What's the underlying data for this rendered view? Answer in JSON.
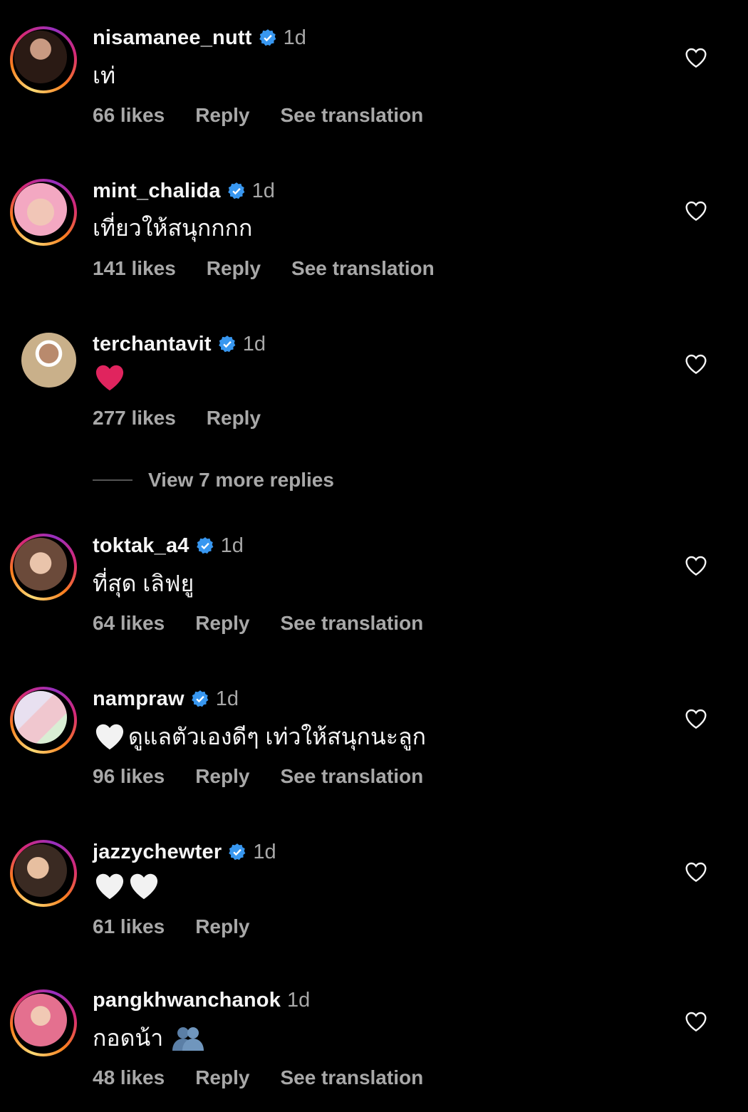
{
  "comments": [
    {
      "username": "nisamanee_nutt",
      "time": "1d",
      "text": "เท่",
      "likes": "66 likes",
      "reply": "Reply",
      "translate": "See translation"
    },
    {
      "username": "mint_chalida",
      "time": "1d",
      "text": "เที่ยวให้สนุกกกก",
      "likes": "141 likes",
      "reply": "Reply",
      "translate": "See translation"
    },
    {
      "username": "terchantavit",
      "time": "1d",
      "likes": "277 likes",
      "reply": "Reply"
    },
    {
      "username": "toktak_a4",
      "time": "1d",
      "text": "ที่สุด เลิฟยู",
      "likes": "64 likes",
      "reply": "Reply",
      "translate": "See translation"
    },
    {
      "username": "nampraw",
      "time": "1d",
      "text": "ดูแลตัวเองดีๆ เท่วให้สนุกนะลูก",
      "likes": "96 likes",
      "reply": "Reply",
      "translate": "See translation"
    },
    {
      "username": "jazzychewter",
      "time": "1d",
      "likes": "61 likes",
      "reply": "Reply"
    },
    {
      "username": "pangkhwanchanok",
      "time": "1d",
      "text": "กอดน้า",
      "likes": "48 likes",
      "reply": "Reply",
      "translate": "See translation"
    }
  ],
  "view_more": "View 7 more replies",
  "colors": {
    "background": "#000000",
    "muted": "#a8a8a8",
    "verified": "#3897f0",
    "red_heart": "#e0245e"
  }
}
